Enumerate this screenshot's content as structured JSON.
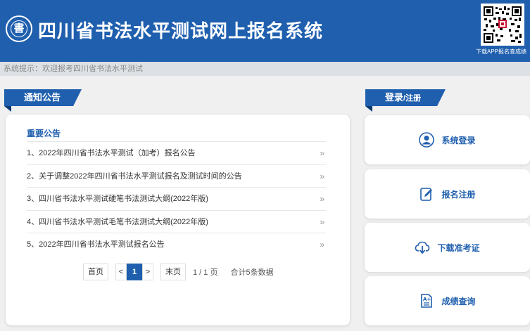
{
  "header": {
    "logo_char": "書",
    "title": "四川省书法水平测试网上报名系统",
    "qr_caption": "下载APP报名查成绩"
  },
  "notice_bar": {
    "text": "系统提示：欢迎报考四川省书法水平测试"
  },
  "announcements": {
    "section_title": "通知公告",
    "heading": "重要公告",
    "items": [
      "1、2022年四川省书法水平测试（加考）报名公告",
      "2、关于调整2022年四川省书法水平测试报名及测试时间的公告",
      "3、四川省书法水平测试硬笔书法测试大纲(2022年版)",
      "4、四川省书法水平测试毛笔书法测试大纲(2022年版)",
      "5、2022年四川省书法水平测试报名公告"
    ],
    "arrow": "»",
    "pager": {
      "first": "首页",
      "prev": "<",
      "current": "1",
      "next": ">",
      "last": "末页",
      "info": "1 / 1 页",
      "total": "合计5条数据"
    }
  },
  "login": {
    "section_title_main": "登录",
    "section_title_sub": "/注册",
    "buttons": [
      {
        "label": "系统登录",
        "icon": "user-icon"
      },
      {
        "label": "报名注册",
        "icon": "edit-form-icon"
      },
      {
        "label": "下载准考证",
        "icon": "cloud-download-icon"
      },
      {
        "label": "成绩查询",
        "icon": "score-document-icon"
      }
    ]
  },
  "colors": {
    "brand_blue": "#1f5fae",
    "ribbon_fold": "#0d3a74"
  }
}
